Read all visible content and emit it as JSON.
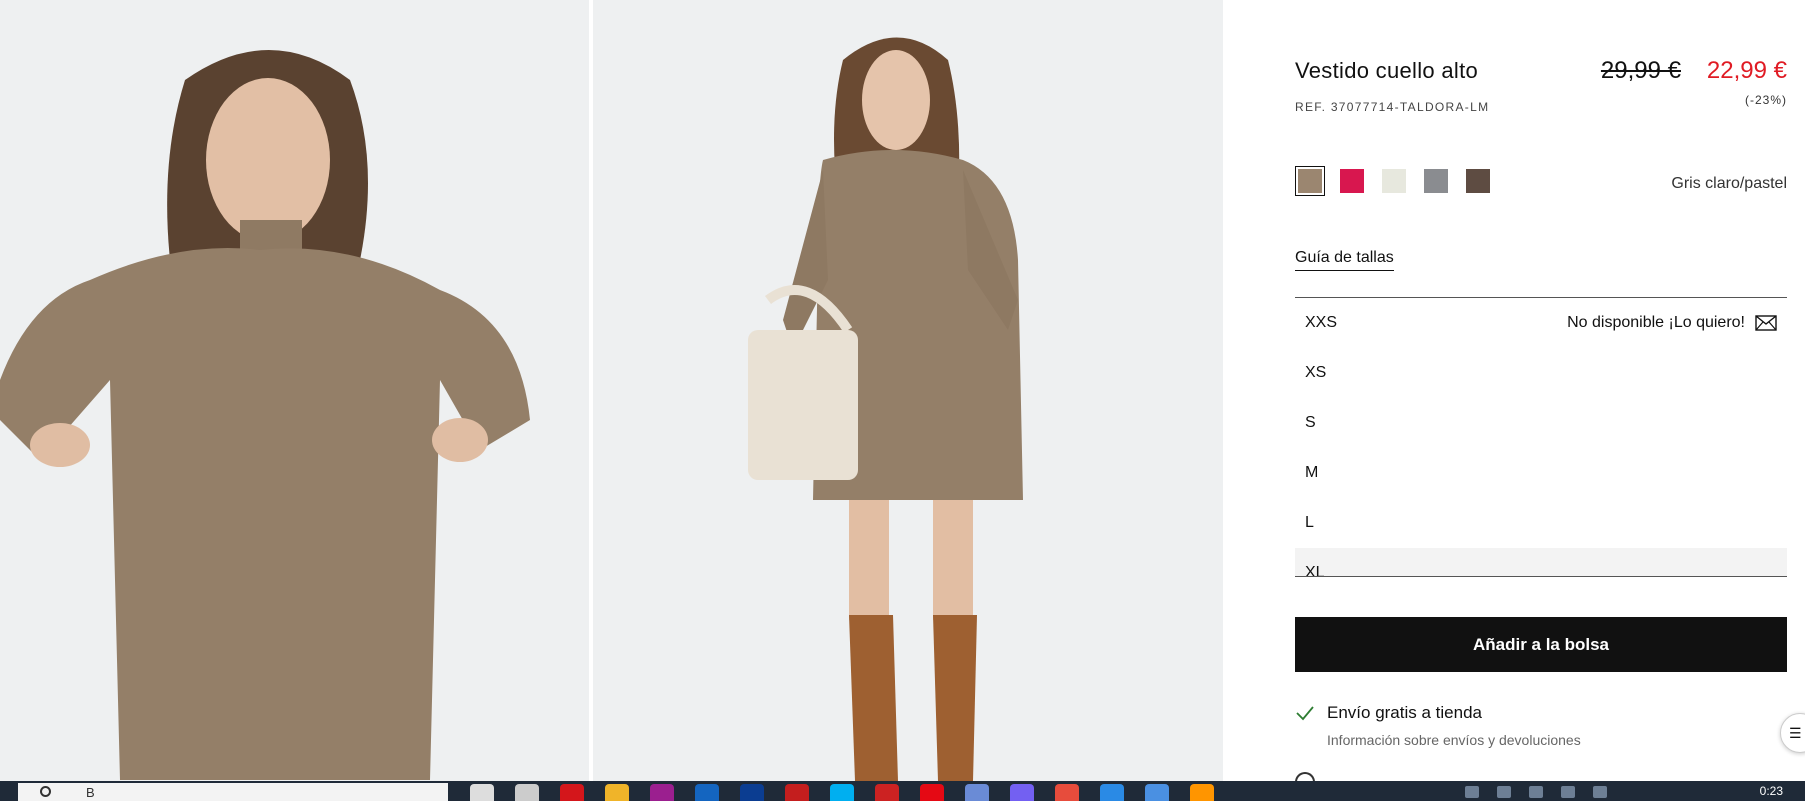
{
  "product": {
    "title": "Vestido cuello alto",
    "ref": "REF. 37077714-TALDORA-LM",
    "price_old": "29,99 €",
    "price_new": "22,99 €",
    "discount": "(-23%)",
    "color_name": "Gris claro/pastel",
    "colors": [
      {
        "name": "taupe",
        "hex": "#9b8670",
        "selected": true
      },
      {
        "name": "fuchsia",
        "hex": "#d8174f",
        "selected": false
      },
      {
        "name": "cream",
        "hex": "#e7e8de",
        "selected": false
      },
      {
        "name": "grey",
        "hex": "#8a8c90",
        "selected": false
      },
      {
        "name": "brown",
        "hex": "#5e4c42",
        "selected": false
      }
    ],
    "size_guide": "Guía de tallas",
    "sizes": [
      {
        "label": "XXS",
        "status": "No disponible ¡Lo quiero!"
      },
      {
        "label": "XS",
        "status": ""
      },
      {
        "label": "S",
        "status": ""
      },
      {
        "label": "M",
        "status": ""
      },
      {
        "label": "L",
        "status": ""
      },
      {
        "label": "XL",
        "status": ""
      }
    ],
    "add_to_bag": "Añadir a la bolsa",
    "shipping": {
      "label": "Envío gratis a tienda",
      "info": "Información sobre envíos y devoluciones"
    }
  },
  "taskbar": {
    "search_placeholder": "B",
    "clock": "0:23",
    "apps": [
      {
        "name": "search-app-icon",
        "hex": "#dddddd"
      },
      {
        "name": "task-view-icon",
        "hex": "#cccccc"
      },
      {
        "name": "opera-icon",
        "hex": "#d4161b"
      },
      {
        "name": "file-explorer-icon",
        "hex": "#f0b429"
      },
      {
        "name": "app-purple-icon",
        "hex": "#9b1f8f"
      },
      {
        "name": "app-blue-icon",
        "hex": "#1465c0"
      },
      {
        "name": "app-darkblue-icon",
        "hex": "#0b3d91"
      },
      {
        "name": "app-red-icon",
        "hex": "#c41e1e"
      },
      {
        "name": "skype-icon",
        "hex": "#00aff0"
      },
      {
        "name": "app-circle-icon",
        "hex": "#cc2222"
      },
      {
        "name": "netflix-icon",
        "hex": "#e50914"
      },
      {
        "name": "app-doc-icon",
        "hex": "#6a8bd6"
      },
      {
        "name": "viber-icon",
        "hex": "#7360f2"
      },
      {
        "name": "chrome-icon",
        "hex": "#e74c3c"
      },
      {
        "name": "edge-icon",
        "hex": "#2a8ae5"
      },
      {
        "name": "app-x-icon",
        "hex": "#4a90e2"
      },
      {
        "name": "firefox-icon",
        "hex": "#ff9500"
      }
    ]
  },
  "colors": {
    "price_sale": "#e01b24",
    "button_bg": "#111111",
    "check_green": "#2e7d32"
  }
}
